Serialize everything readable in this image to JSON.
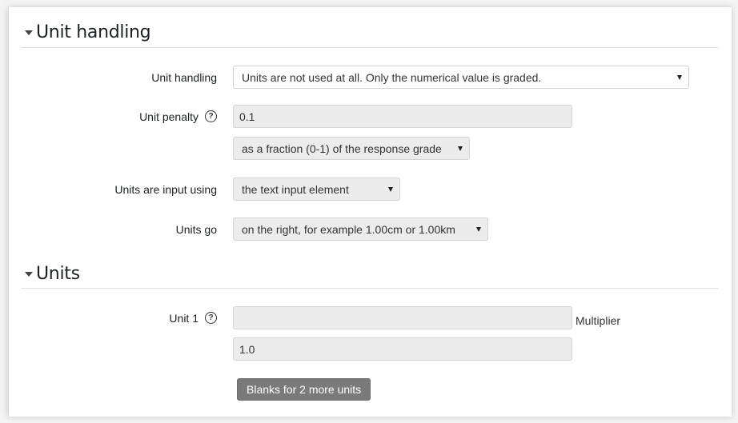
{
  "sections": {
    "unit_handling": {
      "title": "Unit handling",
      "fields": {
        "unit_handling": {
          "label": "Unit handling",
          "selected": "Units are not used at all. Only the numerical value is graded."
        },
        "unit_penalty": {
          "label": "Unit penalty",
          "value": "0.1",
          "mode_selected": "as a fraction (0-1) of the response grade",
          "help_icon": "question-circle-icon"
        },
        "units_input": {
          "label": "Units are input using",
          "selected": "the text input element"
        },
        "units_go": {
          "label": "Units go",
          "selected": "on the right, for example 1.00cm or 1.00km"
        }
      }
    },
    "units": {
      "title": "Units",
      "unit1": {
        "label": "Unit 1",
        "value": "",
        "help_icon": "question-circle-icon",
        "multiplier_label": "Multiplier",
        "multiplier_value": "1.0"
      },
      "add_blanks_button": "Blanks for 2 more units"
    }
  },
  "icons": {
    "help": "?"
  }
}
